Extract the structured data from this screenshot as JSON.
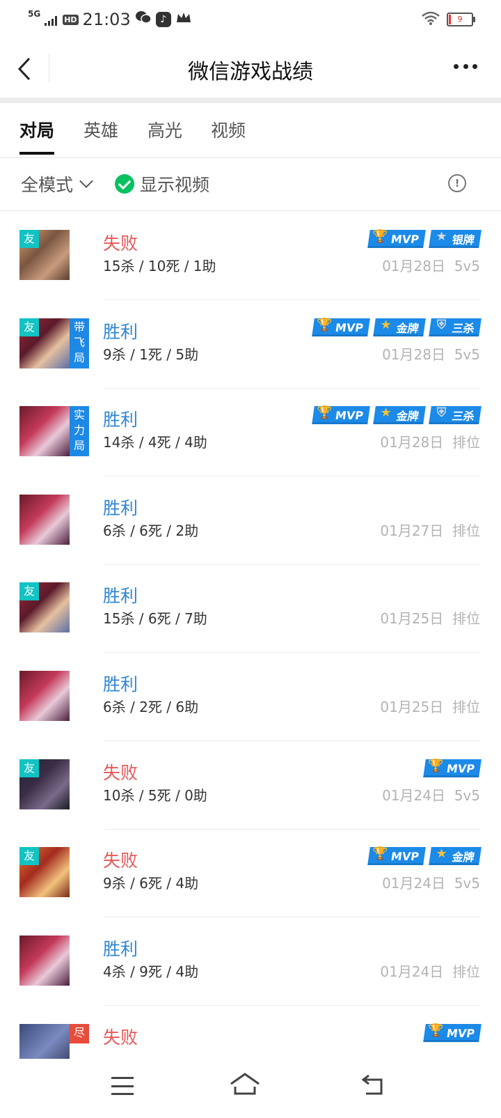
{
  "status": {
    "network": "5G",
    "hd": "HD",
    "time": "21:03",
    "battery": "9",
    "icons": [
      "wechat-icon",
      "tiktok-icon",
      "crown-icon",
      "wifi-icon",
      "battery-icon"
    ]
  },
  "header": {
    "title": "微信游戏战绩"
  },
  "tabs": [
    {
      "label": "对局",
      "active": true
    },
    {
      "label": "英雄",
      "active": false
    },
    {
      "label": "高光",
      "active": false
    },
    {
      "label": "视频",
      "active": false
    }
  ],
  "filter": {
    "mode_label": "全模式",
    "video_label": "显示视频",
    "info_symbol": "!"
  },
  "matches": [
    {
      "result": "失败",
      "kda": "15杀 / 10死 / 1助",
      "date": "01月28日",
      "mode": "5v5",
      "friend_tag": "友",
      "side_tag": "",
      "badges": [
        "MVP",
        "银牌"
      ]
    },
    {
      "result": "胜利",
      "kda": "9杀 / 1死 / 5助",
      "date": "01月28日",
      "mode": "5v5",
      "friend_tag": "友",
      "side_tag": "带飞局",
      "badges": [
        "MVP",
        "金牌",
        "三杀"
      ]
    },
    {
      "result": "胜利",
      "kda": "14杀 / 4死 / 4助",
      "date": "01月28日",
      "mode": "排位",
      "friend_tag": "",
      "side_tag": "实力局",
      "badges": [
        "MVP",
        "金牌",
        "三杀"
      ]
    },
    {
      "result": "胜利",
      "kda": "6杀 / 6死 / 2助",
      "date": "01月27日",
      "mode": "排位",
      "friend_tag": "",
      "side_tag": "",
      "badges": []
    },
    {
      "result": "胜利",
      "kda": "15杀 / 6死 / 7助",
      "date": "01月25日",
      "mode": "排位",
      "friend_tag": "友",
      "side_tag": "",
      "badges": []
    },
    {
      "result": "胜利",
      "kda": "6杀 / 2死 / 6助",
      "date": "01月25日",
      "mode": "排位",
      "friend_tag": "",
      "side_tag": "",
      "badges": []
    },
    {
      "result": "失败",
      "kda": "10杀 / 5死 / 0助",
      "date": "01月24日",
      "mode": "5v5",
      "friend_tag": "友",
      "side_tag": "",
      "badges": [
        "MVP"
      ]
    },
    {
      "result": "失败",
      "kda": "9杀 / 6死 / 4助",
      "date": "01月24日",
      "mode": "5v5",
      "friend_tag": "友",
      "side_tag": "",
      "badges": [
        "MVP",
        "金牌"
      ]
    },
    {
      "result": "胜利",
      "kda": "4杀 / 9死 / 4助",
      "date": "01月24日",
      "mode": "排位",
      "friend_tag": "",
      "side_tag": "",
      "badges": []
    },
    {
      "result": "失败",
      "kda": "",
      "date": "",
      "mode": "",
      "friend_tag": "",
      "side_tag": "尽",
      "badges": [
        "MVP"
      ]
    }
  ],
  "colors": {
    "win": "#2f86d1",
    "lose": "#e5595a",
    "friend_tag": "#13c2c2",
    "badge": "#1b8ae8",
    "check": "#07c160"
  },
  "bottom_nav": [
    "menu-icon",
    "home-icon",
    "back-icon"
  ]
}
